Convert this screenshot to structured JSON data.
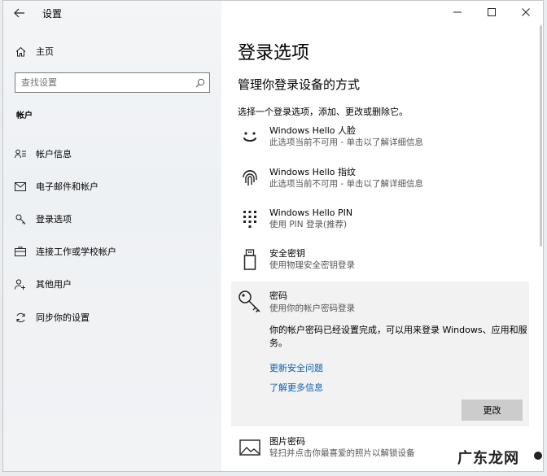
{
  "app": {
    "title": "设置",
    "back_icon": "back-arrow-icon"
  },
  "window_controls": {
    "minimize": "—",
    "maximize": "☐",
    "close": "✕"
  },
  "sidebar": {
    "home_label": "主页",
    "search_placeholder": "查找设置",
    "section_title": "帐户",
    "items": [
      {
        "label": "帐户信息",
        "icon": "person-list-icon"
      },
      {
        "label": "电子邮件和帐户",
        "icon": "mail-icon"
      },
      {
        "label": "登录选项",
        "icon": "key-icon"
      },
      {
        "label": "连接工作或学校帐户",
        "icon": "briefcase-icon"
      },
      {
        "label": "其他用户",
        "icon": "person-add-icon"
      },
      {
        "label": "同步你的设置",
        "icon": "sync-icon"
      }
    ]
  },
  "main": {
    "title": "登录选项",
    "subtitle": "管理你登录设备的方式",
    "intro": "选择一个登录选项，添加、更改或删除它。",
    "options": [
      {
        "title": "Windows Hello 人脸",
        "desc": "此选项当前不可用 - 单击以了解详细信息",
        "icon": "face-icon"
      },
      {
        "title": "Windows Hello 指纹",
        "desc": "此选项当前不可用 - 单击以了解详细信息",
        "icon": "fingerprint-icon"
      },
      {
        "title": "Windows Hello PIN",
        "desc": "使用 PIN 登录(推荐)",
        "icon": "pin-keypad-icon"
      },
      {
        "title": "安全密钥",
        "desc": "使用物理安全密钥登录",
        "icon": "usb-key-icon"
      }
    ],
    "password": {
      "title": "密码",
      "desc": "使用你的帐户密码登录",
      "detail": "你的帐户密码已经设置完成，可以用来登录 Windows、应用和服务。",
      "link1": "更新安全问题",
      "link2": "了解更多信息",
      "button": "更改",
      "icon": "key-icon"
    },
    "picture_password": {
      "title": "图片密码",
      "desc": "轻扫并点击你最喜爱的照片以解锁设备",
      "icon": "picture-icon"
    }
  },
  "watermark": "广东龙网"
}
